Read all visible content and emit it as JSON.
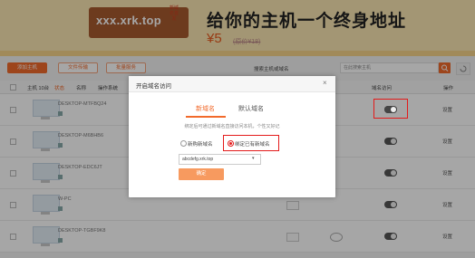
{
  "banner": {
    "domain": "xxx.xrk.top",
    "badge": "新域名首发",
    "headline": "给你的主机一个终身地址",
    "price": "¥5",
    "old_price": "(原价¥18)"
  },
  "toolbar": {
    "add_host": "添加主机",
    "file_transfer": "文件传输",
    "batch_service": "批量服务",
    "search_label": "搜索主机或域名",
    "search_placeholder": "在此搜索主机"
  },
  "table": {
    "headers": [
      "主机 10台",
      "状态",
      "名称",
      "操作系统",
      "域名访问",
      "操作"
    ],
    "rows": [
      {
        "name": "DESKTOP-MTFBQ24",
        "settings": "设置"
      },
      {
        "name": "DESKTOP-M6BHB6",
        "settings": "设置"
      },
      {
        "name": "DESKTOP-EDC6JT",
        "settings": "设置"
      },
      {
        "name": "W-PC",
        "settings": "设置"
      },
      {
        "name": "DESKTOP-TGBF9K8",
        "settings": "设置"
      }
    ]
  },
  "modal": {
    "title": "开启域名访问",
    "close": "×",
    "tabs": [
      "新域名",
      "默认域名"
    ],
    "hint": "绑定后可通过新域名直接访问本机，个性又好记",
    "option_new": "新购新域名",
    "option_existing": "绑定已有新域名",
    "select_value": "abcdefg.xrk.top",
    "confirm": "确定"
  },
  "colors": {
    "accent": "#f26a2b",
    "highlight": "#e31a1a",
    "banner_bg": "#fbe6b3"
  }
}
